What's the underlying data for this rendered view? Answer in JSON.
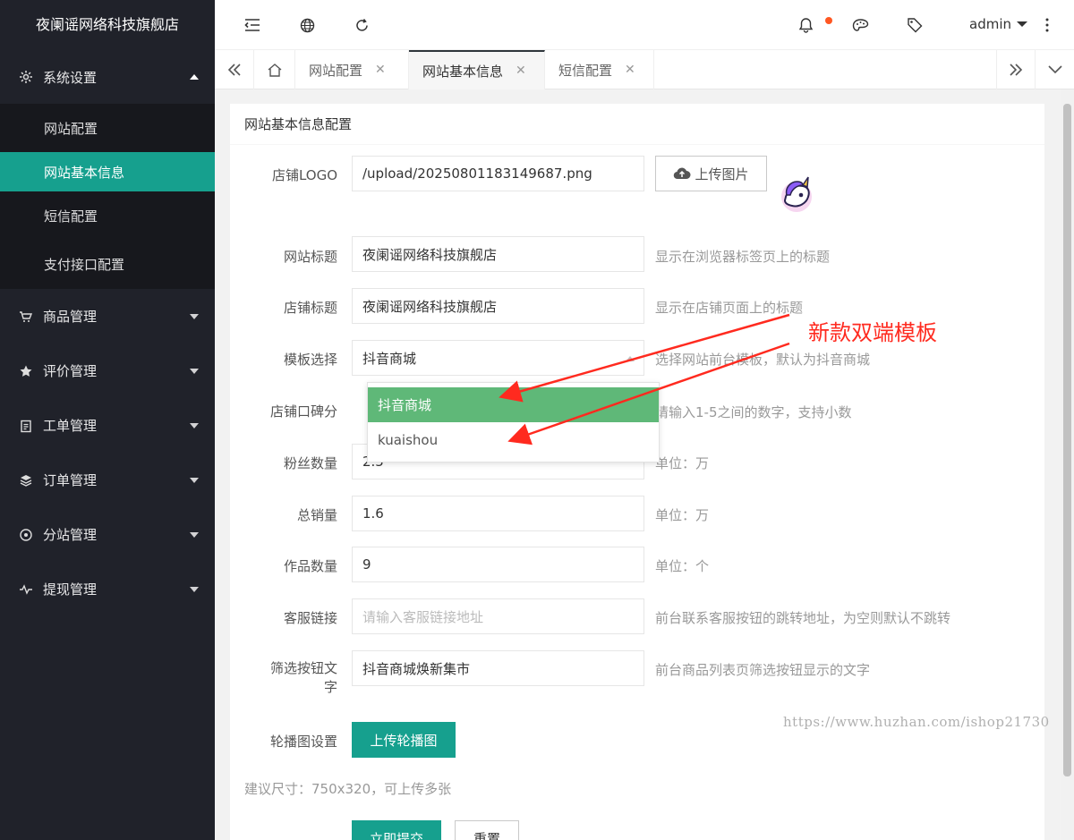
{
  "brand": "夜阑谣网络科技旗舰店",
  "sidebar": {
    "system": {
      "label": "系统设置",
      "icon": "gear-icon"
    },
    "sub_items": [
      {
        "label": "网站配置",
        "active": false
      },
      {
        "label": "网站基本信息",
        "active": true
      },
      {
        "label": "短信配置",
        "active": false
      },
      {
        "label": "支付接口配置",
        "active": false
      }
    ],
    "groups": [
      {
        "label": "商品管理",
        "icon": "cart-icon"
      },
      {
        "label": "评价管理",
        "icon": "star-icon"
      },
      {
        "label": "工单管理",
        "icon": "clipboard-icon"
      },
      {
        "label": "订单管理",
        "icon": "layers-icon"
      },
      {
        "label": "分站管理",
        "icon": "network-icon"
      },
      {
        "label": "提现管理",
        "icon": "pulse-icon"
      }
    ]
  },
  "header": {
    "user": "admin"
  },
  "tabs": [
    {
      "label": "网站配置",
      "active": false
    },
    {
      "label": "网站基本信息",
      "active": true
    },
    {
      "label": "短信配置",
      "active": false
    }
  ],
  "card": {
    "title": "网站基本信息配置",
    "logo": {
      "label": "店铺LOGO",
      "value": "/upload/20250801183149687.png",
      "upload": "上传图片"
    },
    "site_title": {
      "label": "网站标题",
      "value": "夜阑谣网络科技旗舰店",
      "tip": "显示在浏览器标签页上的标题"
    },
    "shop_title": {
      "label": "店铺标题",
      "value": "夜阑谣网络科技旗舰店",
      "tip": "显示在店铺页面上的标题"
    },
    "template": {
      "label": "模板选择",
      "value": "抖音商城",
      "tip": "选择网站前台模板，默认为抖音商城",
      "options": [
        "抖音商城",
        "kuaishou"
      ]
    },
    "score": {
      "label": "店铺口碑分",
      "tip": "请输入1-5之间的数字，支持小数"
    },
    "fans": {
      "label": "粉丝数量",
      "value": "2.5",
      "tip": "单位：万"
    },
    "sales": {
      "label": "总销量",
      "value": "1.6",
      "tip": "单位：万"
    },
    "works": {
      "label": "作品数量",
      "value": "9",
      "tip": "单位：个"
    },
    "service": {
      "label": "客服链接",
      "placeholder": "请输入客服链接地址",
      "tip": "前台联系客服按钮的跳转地址，为空则默认不跳转"
    },
    "filter": {
      "label_line1": "筛选按钮文",
      "label_line2": "字",
      "value": "抖音商城焕新集市",
      "tip": "前台商品列表页筛选按钮显示的文字"
    },
    "banner": {
      "label": "轮播图设置",
      "button": "上传轮播图",
      "hint": "建议尺寸：750x320，可上传多张"
    },
    "submit": "立即提交",
    "reset": "重置"
  },
  "annotation": "新款双端模板",
  "watermark": "https://www.huzhan.com/ishop21730",
  "colors": {
    "accent": "#16a08e",
    "sidebar": "#20222a",
    "option_selected": "#5fb878",
    "annotation": "#ff2a1f"
  }
}
